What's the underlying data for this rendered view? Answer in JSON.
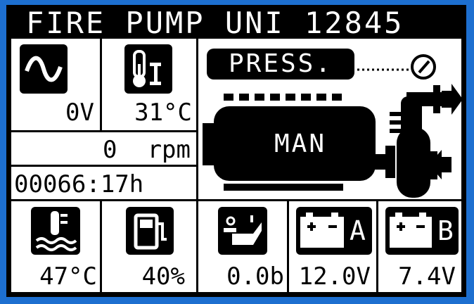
{
  "header": {
    "title": "FIRE PUMP UNI 12845"
  },
  "status": {
    "voltage": "0V",
    "temperature": "31°C",
    "speed_value": "0",
    "speed_unit": "rpm",
    "hour_meter": "00066:17h"
  },
  "engine": {
    "pressure_label": "PRESS.",
    "mode_label": "MAN"
  },
  "gauges": {
    "coolant_temp": "47°C",
    "fuel_level": "40%",
    "oil_pressure": "0.0b",
    "battery_a": "12.0V",
    "battery_b": "7.4V"
  },
  "icons": {
    "battery_a_letter": "A",
    "battery_b_letter": "B",
    "battery_signs": "+  -"
  }
}
